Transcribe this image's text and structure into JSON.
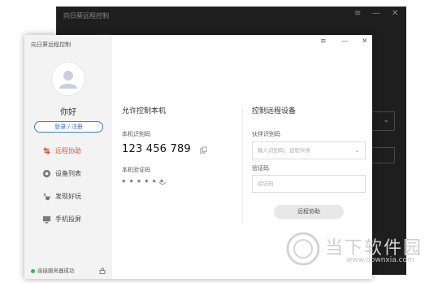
{
  "background_window": {
    "title": "向日葵远程控制",
    "controls": [
      "≡",
      "—",
      "✕"
    ]
  },
  "window": {
    "title": "向日葵远程控制",
    "controls": [
      "≡",
      "—",
      "✕"
    ]
  },
  "sidebar": {
    "username": "你好",
    "login_label": "登录 / 注册",
    "items": [
      {
        "label": "远程协助",
        "icon": "remote-assist-icon",
        "active": true
      },
      {
        "label": "设备列表",
        "icon": "device-list-icon",
        "active": false
      },
      {
        "label": "发现好玩",
        "icon": "discover-icon",
        "active": false
      },
      {
        "label": "手机投屏",
        "icon": "screen-cast-icon",
        "active": false
      }
    ],
    "status_text": "连接服务器成功"
  },
  "allow_control": {
    "title": "允许控制本机",
    "id_label": "本机识别码",
    "id_value": "123 456 789",
    "code_label": "本机验证码",
    "code_value": "* * * * * *"
  },
  "remote_control": {
    "title": "控制远程设备",
    "partner_label": "伙伴识别码",
    "partner_placeholder": "输入识别码、远程伙伴",
    "verify_label": "验证码",
    "verify_placeholder": "验证码",
    "assist_button": "远程协助"
  },
  "watermark": {
    "name": "当下软件园",
    "url": "www.downxia.com"
  },
  "colors": {
    "accent_orange": "#e8543a",
    "accent_blue": "#2b6fd1",
    "status_green": "#2dbb4f"
  }
}
